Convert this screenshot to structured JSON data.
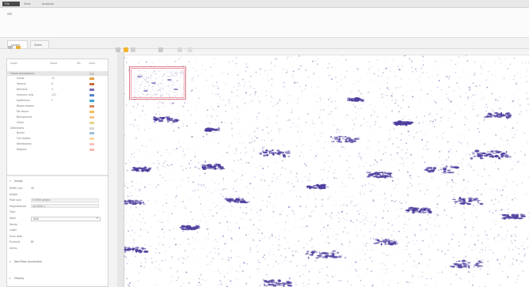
{
  "window": {
    "accent": "#4a4a4a"
  },
  "menu": [
    "File",
    "View",
    "Analysis"
  ],
  "panel_tabs": [
    "Layers",
    "Slides"
  ],
  "layer_panel": {
    "headers": {
      "name": "Layer",
      "count": "Count",
      "vis": "Vis",
      "color": "Color"
    },
    "items": [
      {
        "label": "Tissue Annotations",
        "value": "",
        "color": "#c9c9c9"
      },
      {
        "label": "Tumor",
        "value": "12",
        "color": "#e2a03f"
      },
      {
        "label": "Stroma",
        "value": "8",
        "color": "#c46b3a"
      },
      {
        "label": "Necrosis",
        "value": "4",
        "color": "#7f6fb8"
      },
      {
        "label": "Immune cells",
        "value": "231",
        "color": "#5d85c9"
      },
      {
        "label": "Epithelium",
        "value": "2",
        "color": "#3ca5d6"
      },
      {
        "label": "Blood vessels",
        "value": "",
        "color": "#d08a56"
      },
      {
        "label": "Fat tissue",
        "value": "",
        "color": "#f0c05a"
      },
      {
        "label": "Background",
        "value": "",
        "color": "#f2c88b"
      },
      {
        "label": "Other",
        "value": "",
        "color": "#e8d38a"
      },
      {
        "label": "Detections",
        "value": "",
        "color": "#d8d8d8"
      },
      {
        "label": "Nuclei",
        "value": "",
        "color": "#9fbfd9"
      },
      {
        "label": "Cell bodies",
        "value": "",
        "color": "#f5d6a0"
      },
      {
        "label": "Membranes",
        "value": "",
        "color": "#f7c2c2"
      },
      {
        "label": "Regions",
        "value": "",
        "color": "#f4b9b2"
      }
    ]
  },
  "properties": {
    "title": "Image",
    "rows": [
      {
        "key": "Width (px)",
        "value": "45"
      },
      {
        "key": "Height",
        "value": ""
      },
      {
        "key": "Pixel size",
        "value": "0.2500 µm/px"
      },
      {
        "key": "Magnification",
        "value": "40.0000 x"
      },
      {
        "key": "Type",
        "value": ""
      },
      {
        "key": "Stain",
        "value": "H&E"
      },
      {
        "key": "Vector",
        "value": ""
      },
      {
        "key": "Label",
        "value": ""
      },
      {
        "key": "Scan date",
        "value": ""
      },
      {
        "key": "Pyramid",
        "value": "BF"
      },
      {
        "key": "Series",
        "value": ""
      }
    ]
  },
  "sections": [
    "Workflow Annotation",
    "Display"
  ],
  "colors": {
    "stain": "#4a3a9c",
    "overview_border": "#d97a86",
    "highlight": "#f3b430"
  }
}
